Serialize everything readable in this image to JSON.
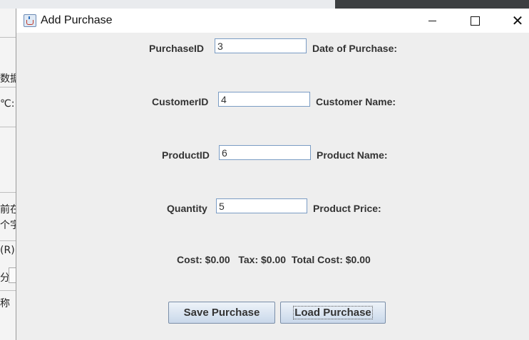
{
  "background_app": {
    "left_texts": [
      "数据",
      "℃:",
      "前在",
      "个字",
      "(R)",
      "分",
      "称"
    ]
  },
  "window": {
    "title": "Add Purchase",
    "controls": {
      "close": "✕"
    }
  },
  "form": {
    "purchase_id": {
      "label": "PurchaseID",
      "value": "3",
      "side_label": "Date of Purchase:"
    },
    "customer_id": {
      "label": "CustomerID",
      "value": "4",
      "side_label": "Customer Name:"
    },
    "product_id": {
      "label": "ProductID",
      "value": "6",
      "side_label": "Product Name:"
    },
    "quantity": {
      "label": "Quantity",
      "value": "5",
      "side_label": "Product Price:"
    },
    "summary": {
      "text": "Cost: $0.00   Tax: $0.00  Total Cost: $0.00"
    }
  },
  "buttons": {
    "save": "Save Purchase",
    "load": "Load Purchase"
  }
}
